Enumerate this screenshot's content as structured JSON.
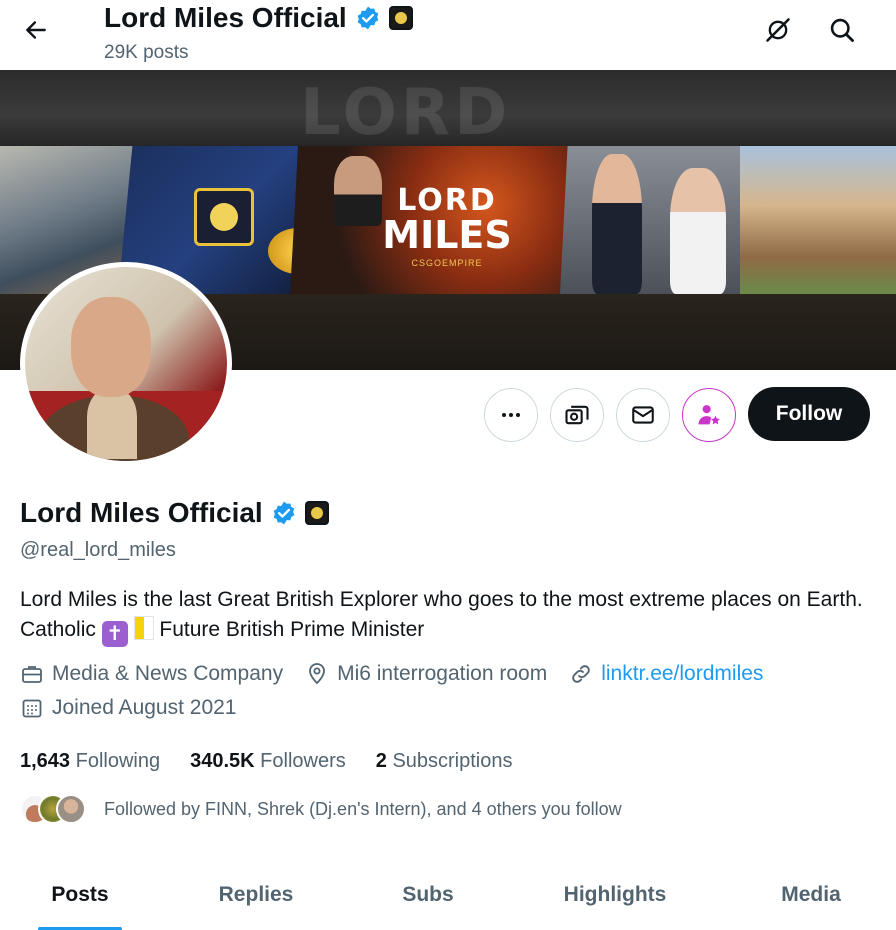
{
  "header": {
    "title": "Lord Miles Official",
    "post_count": "29K posts",
    "icons": [
      "back-arrow-icon",
      "verified-badge-icon",
      "affiliate-badge-icon",
      "grok-slash-icon",
      "search-icon"
    ]
  },
  "banner": {
    "ghost_text": "LORD",
    "brand_line1": "LORD",
    "brand_line2": "MILES",
    "brand_line3": "CSGOEMPIRE"
  },
  "profile": {
    "name": "Lord Miles Official",
    "handle": "@real_lord_miles",
    "bio_part1": "Lord Miles is the last Great British Explorer who goes to the most extreme places on Earth. Catholic ",
    "bio_emoji1": "✝",
    "bio_part2": " Future British Prime Minister",
    "category": "Media & News Company",
    "location": "Mi6 interrogation room",
    "link": "linktr.ee/lordmiles",
    "joined": "Joined August 2021"
  },
  "actions": {
    "follow_label": "Follow",
    "icons": [
      "more-icon",
      "grok-image-icon",
      "message-icon",
      "subscribe-icon"
    ]
  },
  "stats": {
    "following_count": "1,643",
    "following_label": "Following",
    "followers_count": "340.5K",
    "followers_label": "Followers",
    "subscriptions_count": "2",
    "subscriptions_label": "Subscriptions"
  },
  "followed_by": "Followed by FINN, Shrek (Dj.en's Intern), and 4 others you follow",
  "tabs": [
    {
      "label": "Posts",
      "active": true
    },
    {
      "label": "Replies",
      "active": false
    },
    {
      "label": "Subs",
      "active": false
    },
    {
      "label": "Highlights",
      "active": false
    },
    {
      "label": "Media",
      "active": false
    }
  ],
  "colors": {
    "accent": "#1d9bf0",
    "text": "#0f1419",
    "secondary_text": "#536471",
    "subscribe_accent": "#c936c9"
  }
}
